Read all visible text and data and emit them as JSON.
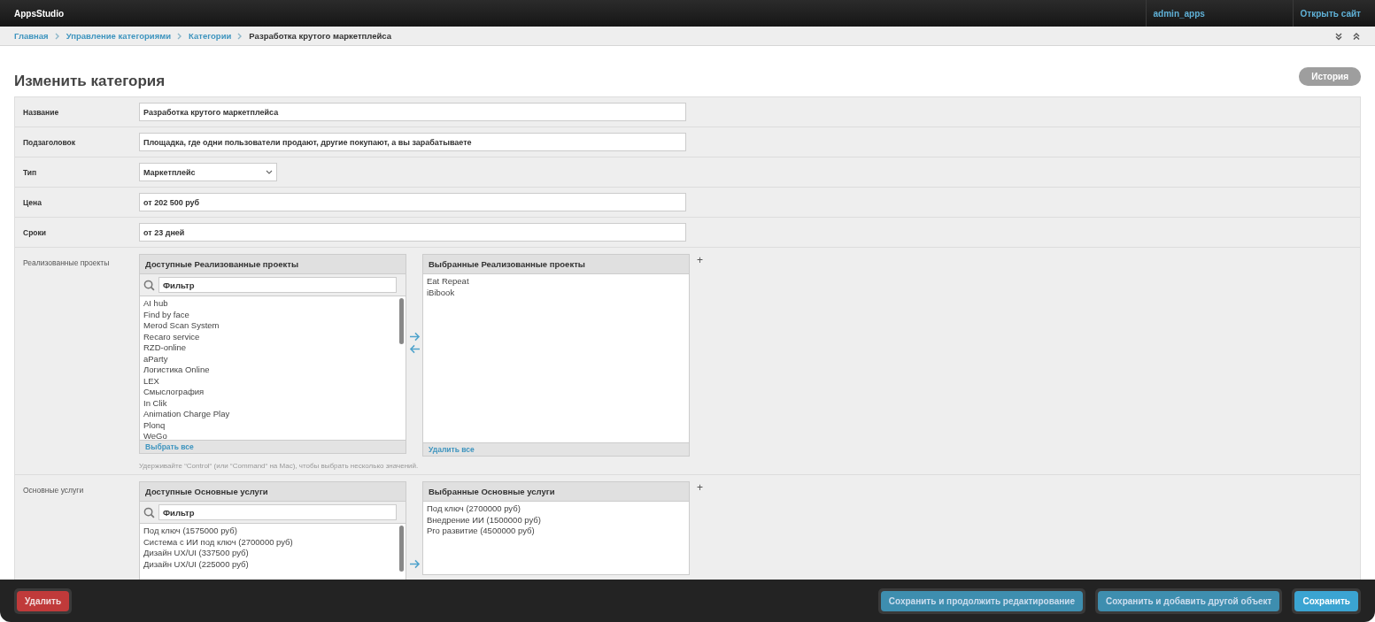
{
  "header": {
    "brand": "AppsStudio",
    "user": "admin_apps",
    "site_link": "Открыть сайт"
  },
  "breadcrumbs": [
    "Главная",
    "Управление категориями",
    "Категории",
    "Разработка крутого маркетплейса"
  ],
  "page_title": "Изменить категория",
  "history_button": "История",
  "fields": [
    {
      "label": "Название",
      "kind": "text",
      "value": "Разработка крутого маркетплейса"
    },
    {
      "label": "Подзаголовок",
      "kind": "text",
      "value": "Площадка, где одни пользователи продают, другие покупают, а вы зарабатываете"
    },
    {
      "label": "Тип",
      "kind": "select",
      "value": "Маркетплейс"
    },
    {
      "label": "Цена",
      "kind": "text",
      "value": "от 202 500 руб"
    },
    {
      "label": "Сроки",
      "kind": "text",
      "value": "от 23 дней"
    }
  ],
  "multiselects": [
    {
      "label": "Реализованные проекты",
      "available_title": "Доступные Реализованные проекты",
      "filter_placeholder": "Фильтр",
      "available": [
        "AI hub",
        "Find by face",
        "Merod Scan System",
        "Recaro service",
        "RZD-online",
        "aParty",
        "Логистика Online",
        "LEX",
        "Смыслография",
        "In Clik",
        "Animation Charge Play",
        "Plonq",
        "WeGo"
      ],
      "choose_all": "Выбрать все",
      "chosen_title": "Выбранные Реализованные проекты",
      "chosen": [
        "Eat Repeat",
        "iBibook"
      ],
      "remove_all": "Удалить все",
      "add": "+",
      "help": "Удерживайте “Control“ (или “Command“ на Mac), чтобы выбрать несколько значений."
    },
    {
      "label": "Основные услуги",
      "available_title": "Доступные Основные услуги",
      "filter_placeholder": "Фильтр",
      "available": [
        "Под ключ (1575000 руб)",
        "Система с ИИ под ключ (2700000 руб)",
        "Дизайн UX/UI (337500 руб)",
        "Дизайн UX/UI (225000 руб)"
      ],
      "chosen_title": "Выбранные Основные услуги",
      "chosen": [
        "Под ключ (2700000 руб)",
        "Внедрение ИИ (1500000 руб)",
        "Pro развитие (4500000 руб)"
      ],
      "add": "+"
    }
  ],
  "footer": {
    "delete_button": "Удалить",
    "buttons": [
      {
        "label": "Сохранить и продолжить редактирование",
        "kind": "secondary"
      },
      {
        "label": "Сохранить и добавить другой объект",
        "kind": "secondary"
      },
      {
        "label": "Сохранить",
        "kind": "primary"
      }
    ]
  }
}
